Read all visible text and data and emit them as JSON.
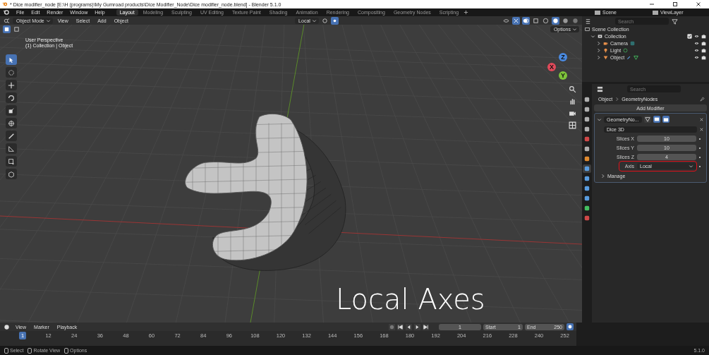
{
  "window": {
    "title": "* Dice modifier_node [E:\\H (programs)\\My Gumroad products\\Dice Modifier_Node\\Dice modifier_node.blend] - Blender 5.1.0"
  },
  "menu": [
    "File",
    "Edit",
    "Render",
    "Window",
    "Help"
  ],
  "workspaces": [
    {
      "label": "Layout",
      "selected": true
    },
    {
      "label": "Modeling",
      "selected": false
    },
    {
      "label": "Sculpting",
      "selected": false
    },
    {
      "label": "UV Editing",
      "selected": false
    },
    {
      "label": "Texture Paint",
      "selected": false
    },
    {
      "label": "Shading",
      "selected": false
    },
    {
      "label": "Animation",
      "selected": false
    },
    {
      "label": "Rendering",
      "selected": false
    },
    {
      "label": "Compositing",
      "selected": false
    },
    {
      "label": "Geometry Nodes",
      "selected": false
    },
    {
      "label": "Scripting",
      "selected": false
    }
  ],
  "scene": "Scene",
  "view_layer": "ViewLayer",
  "viewport": {
    "mode": "Object Mode",
    "menus": [
      "View",
      "Select",
      "Add",
      "Object"
    ],
    "orientation": "Local",
    "options": "Options",
    "overlay_lines": [
      "User Perspective",
      "(1) Collection | Object"
    ],
    "caption": "Local Axes",
    "gizmo": [
      "X",
      "Y",
      "Z"
    ],
    "tools": [
      {
        "kind": "select",
        "selected": true
      },
      {
        "kind": "cursor",
        "selected": false
      },
      {
        "kind": "move",
        "selected": false
      },
      {
        "kind": "rotate",
        "selected": false
      },
      {
        "kind": "scale",
        "selected": false
      },
      {
        "kind": "transform",
        "selected": false
      },
      {
        "kind": "annotate",
        "selected": false
      },
      {
        "kind": "measure",
        "selected": false
      },
      {
        "kind": "add",
        "selected": false
      },
      {
        "kind": "cube",
        "selected": false
      }
    ]
  },
  "outliner": {
    "search": {
      "placeholder": "Search"
    },
    "tree": [
      {
        "label": "Scene Collection",
        "kind": "scene",
        "children": [
          {
            "label": "Collection",
            "kind": "collection",
            "expanded": true,
            "checked": true,
            "children": [
              {
                "label": "Camera",
                "kind": "camera",
                "expanded": false
              },
              {
                "label": "Light",
                "kind": "light",
                "expanded": false
              },
              {
                "label": "Object",
                "kind": "object",
                "expanded": false
              }
            ]
          }
        ]
      }
    ]
  },
  "properties": {
    "search": {
      "placeholder": "Search"
    },
    "breadcrumb": [
      "Object",
      "GeometryNodes"
    ],
    "tabs": [
      {
        "color": "#b0b0b0",
        "selected": false
      },
      {
        "color": "#b0b0b0",
        "selected": false
      },
      {
        "color": "#b0b0b0",
        "selected": false
      },
      {
        "color": "#b0b0b0",
        "selected": false
      },
      {
        "color": "#d04848",
        "selected": false
      },
      {
        "color": "#b0b0b0",
        "selected": false
      },
      {
        "color": "#e08a30",
        "selected": false
      },
      {
        "color": "#5a9de0",
        "selected": true
      },
      {
        "color": "#5a9de0",
        "selected": false
      },
      {
        "color": "#5a9de0",
        "selected": false
      },
      {
        "color": "#5a9de0",
        "selected": false
      },
      {
        "color": "#44c060",
        "selected": false
      },
      {
        "color": "#d04848",
        "selected": false
      }
    ],
    "add_modifier": "Add Modifier",
    "modifier": {
      "name": "GeometryNo...",
      "expanded": true,
      "node_group": "Dice 3D",
      "fields": [
        {
          "label": "Slices X",
          "value": "10",
          "kind": "number",
          "highlighted": false
        },
        {
          "label": "Slices Y",
          "value": "10",
          "kind": "number",
          "highlighted": false
        },
        {
          "label": "Slices Z",
          "value": "4",
          "kind": "number",
          "highlighted": false
        },
        {
          "label": "Axis",
          "value": "Local",
          "kind": "dropdown",
          "highlighted": true
        }
      ],
      "panels": [
        {
          "label": "Manage",
          "expanded": false
        }
      ]
    }
  },
  "timeline": {
    "menus": [
      "View",
      "Marker",
      "Playback"
    ],
    "current_frame": "1",
    "start_label": "Start",
    "start": "1",
    "end_label": "End",
    "end": "250",
    "playhead": "1",
    "ticks": [
      "12",
      "24",
      "36",
      "48",
      "60",
      "72",
      "84",
      "96",
      "108",
      "120",
      "132",
      "144",
      "156",
      "168",
      "180",
      "192",
      "204",
      "216",
      "228",
      "240",
      "252"
    ]
  },
  "status_bar": {
    "hints": [
      "Select",
      "Rotate View",
      "Options"
    ],
    "version": "5.1.0"
  }
}
